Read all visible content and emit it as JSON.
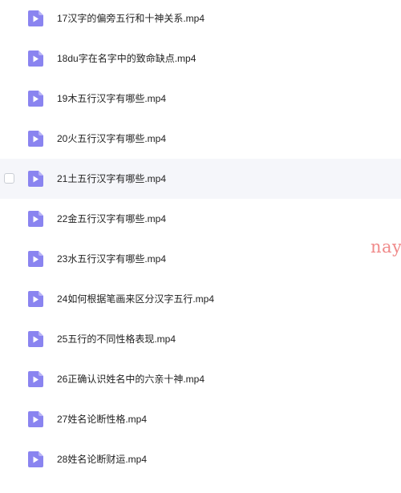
{
  "files": [
    {
      "name": "17汉字的偏旁五行和十神关系.mp4",
      "icon": "video-file-icon"
    },
    {
      "name": "18du字在名字中的致命缺点.mp4",
      "icon": "video-file-icon"
    },
    {
      "name": "19木五行汉字有哪些.mp4",
      "icon": "video-file-icon"
    },
    {
      "name": "20火五行汉字有哪些.mp4",
      "icon": "video-file-icon"
    },
    {
      "name": "21土五行汉字有哪些.mp4",
      "icon": "video-file-icon"
    },
    {
      "name": "22金五行汉字有哪些.mp4",
      "icon": "video-file-icon"
    },
    {
      "name": "23水五行汉字有哪些.mp4",
      "icon": "video-file-icon"
    },
    {
      "name": "24如何根据笔画来区分汉字五行.mp4",
      "icon": "video-file-icon"
    },
    {
      "name": "25五行的不同性格表现.mp4",
      "icon": "video-file-icon"
    },
    {
      "name": "26正确认识姓名中的六亲十神.mp4",
      "icon": "video-file-icon"
    },
    {
      "name": "27姓名论断性格.mp4",
      "icon": "video-file-icon"
    },
    {
      "name": "28姓名论断财运.mp4",
      "icon": "video-file-icon"
    }
  ],
  "watermark": "nay",
  "colors": {
    "icon_fill": "#8a84f0",
    "icon_fold": "#b7b3f7",
    "row_hover_bg": "#f5f6fa",
    "text": "#1f1f1f",
    "watermark": "#f08a8a"
  }
}
